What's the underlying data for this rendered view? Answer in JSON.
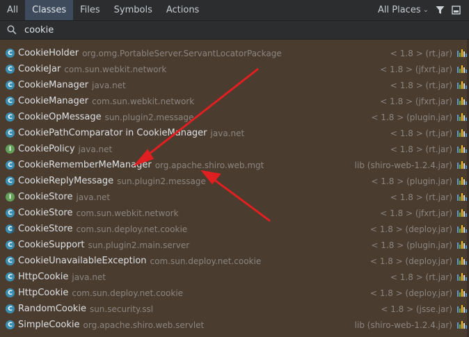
{
  "tabs": [
    {
      "label": "All",
      "active": false
    },
    {
      "label": "Classes",
      "active": true
    },
    {
      "label": "Files",
      "active": false
    },
    {
      "label": "Symbols",
      "active": false
    },
    {
      "label": "Actions",
      "active": false
    }
  ],
  "scope": {
    "label": "All Places"
  },
  "search": {
    "value": "cookie"
  },
  "results": [
    {
      "icon": "class",
      "name": "CookieHolder",
      "pkg": "org.omg.PortableServer.ServantLocatorPackage",
      "loc": "< 1.8 > (rt.jar)"
    },
    {
      "icon": "class",
      "name": "CookieJar",
      "pkg": "com.sun.webkit.network",
      "loc": "< 1.8 > (jfxrt.jar)"
    },
    {
      "icon": "class",
      "name": "CookieManager",
      "pkg": "java.net",
      "loc": "< 1.8 > (rt.jar)"
    },
    {
      "icon": "class",
      "name": "CookieManager",
      "pkg": "com.sun.webkit.network",
      "loc": "< 1.8 > (jfxrt.jar)"
    },
    {
      "icon": "class",
      "name": "CookieOpMessage",
      "pkg": "sun.plugin2.message",
      "loc": "< 1.8 > (plugin.jar)"
    },
    {
      "icon": "class",
      "name": "CookiePathComparator in CookieManager",
      "pkg": "java.net",
      "loc": "< 1.8 > (rt.jar)"
    },
    {
      "icon": "iface",
      "name": "CookiePolicy",
      "pkg": "java.net",
      "loc": "< 1.8 > (rt.jar)"
    },
    {
      "icon": "class",
      "name": "CookieRememberMeManager",
      "pkg": "org.apache.shiro.web.mgt",
      "loc": "lib (shiro-web-1.2.4.jar)"
    },
    {
      "icon": "class",
      "name": "CookieReplyMessage",
      "pkg": "sun.plugin2.message",
      "loc": "< 1.8 > (plugin.jar)"
    },
    {
      "icon": "iface",
      "name": "CookieStore",
      "pkg": "java.net",
      "loc": "< 1.8 > (rt.jar)"
    },
    {
      "icon": "class",
      "name": "CookieStore",
      "pkg": "com.sun.webkit.network",
      "loc": "< 1.8 > (jfxrt.jar)"
    },
    {
      "icon": "cls2",
      "name": "CookieStore",
      "pkg": "com.sun.deploy.net.cookie",
      "loc": "< 1.8 > (deploy.jar)"
    },
    {
      "icon": "class",
      "name": "CookieSupport",
      "pkg": "sun.plugin2.main.server",
      "loc": "< 1.8 > (plugin.jar)"
    },
    {
      "icon": "class",
      "name": "CookieUnavailableException",
      "pkg": "com.sun.deploy.net.cookie",
      "loc": "< 1.8 > (deploy.jar)"
    },
    {
      "icon": "class",
      "name": "HttpCookie",
      "pkg": "java.net",
      "loc": "< 1.8 > (rt.jar)"
    },
    {
      "icon": "class",
      "name": "HttpCookie",
      "pkg": "com.sun.deploy.net.cookie",
      "loc": "< 1.8 > (deploy.jar)"
    },
    {
      "icon": "class",
      "name": "RandomCookie",
      "pkg": "sun.security.ssl",
      "loc": "< 1.8 > (jsse.jar)"
    },
    {
      "icon": "class",
      "name": "SimpleCookie",
      "pkg": "org.apache.shiro.web.servlet",
      "loc": "lib (shiro-web-1.2.4.jar)"
    }
  ],
  "colors": {
    "accent_tab": "#3d4b5c",
    "arrow": "#e02020",
    "background": "#4b3c30"
  }
}
